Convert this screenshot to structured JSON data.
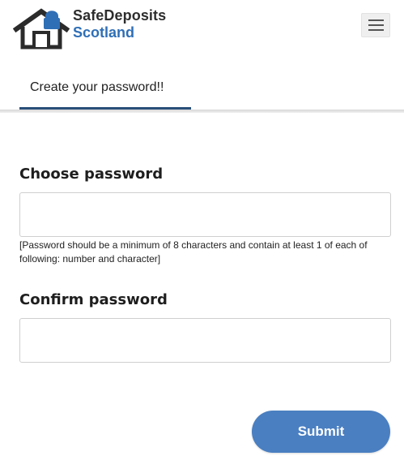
{
  "brand": {
    "name_line1": "SafeDeposits",
    "name_line2": "Scotland",
    "logo_icon": "house-icon",
    "colors": {
      "dark": "#2d2d2d",
      "blue": "#2f6fb6"
    }
  },
  "header": {
    "menu_icon": "hamburger-menu-icon"
  },
  "tabs": [
    {
      "label": "Create your password!!",
      "active": true
    }
  ],
  "form": {
    "password": {
      "label": "Choose password",
      "value": "",
      "placeholder": "",
      "hint": "[Password should be a minimum of 8 characters and contain at least 1 of each of following: number and character]"
    },
    "confirm": {
      "label": "Confirm password",
      "value": "",
      "placeholder": ""
    },
    "submit_label": "Submit"
  },
  "colors": {
    "accent": "#4a7fc1",
    "tab_underline": "#2a4f79",
    "field_border": "#cfcfcf"
  }
}
